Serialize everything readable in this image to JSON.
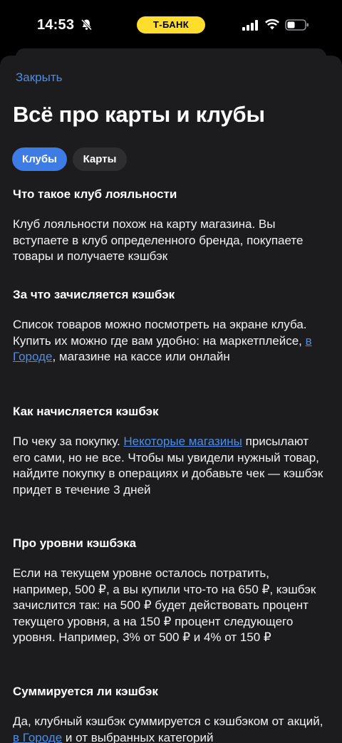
{
  "status_bar": {
    "time": "14:53",
    "bank_label": "Т-БАНК"
  },
  "icons": {
    "bell": "bell-slash-icon",
    "signal": "cellular-signal-icon",
    "wifi": "wifi-icon",
    "battery": "battery-icon"
  },
  "colors": {
    "accent": "#3d7be5",
    "link": "#4c8de8",
    "brand_yellow": "#ffdd2d",
    "sheet_bg": "#1c1c1e"
  },
  "header": {
    "close": "Закрыть",
    "title": "Всё про карты и клубы"
  },
  "tabs": [
    {
      "label": "Клубы",
      "selected": true
    },
    {
      "label": "Карты",
      "selected": false
    }
  ],
  "sections": [
    {
      "heading": "Что такое клуб лояльности",
      "text": "Клуб лояльности похож на карту магазина. Вы вступаете в клуб определенного бренда, покупаете товары и получаете кэшбэк"
    },
    {
      "heading": "За что зачисляется кэшбэк",
      "text_before": "Список товаров можно посмотреть на экране клуба. Купить их можно где вам удобно: на маркетплейсе, ",
      "link": "в Городе",
      "text_after": ", магазине на кассе или онлайн"
    },
    {
      "heading": "Как начисляется кэшбэк",
      "text_before": "По чеку за покупку. ",
      "link": "Некоторые магазины",
      "text_after": " присылают его сами, но не все. Чтобы мы увидели нужный товар, найдите покупку в операциях и добавьте чек — кэшбэк придет в течение 3 дней"
    },
    {
      "heading": "Про уровни кэшбэка",
      "text": "Если на текущем уровне осталось потратить, например, 500 ₽, а вы купили что-то на 650 ₽, кэшбэк зачислится так: на 500 ₽ будет действовать процент текущего уровня, а на 150 ₽ процент следующего уровня. Например, 3% от 500 ₽ и 4% от 150 ₽"
    },
    {
      "heading": "Суммируется ли кэшбэк",
      "text_before": "Да, клубный кэшбэк суммируется с кэшбэком от акций, ",
      "link": "в Городе",
      "text_after": " и от выбранных категорий"
    }
  ]
}
